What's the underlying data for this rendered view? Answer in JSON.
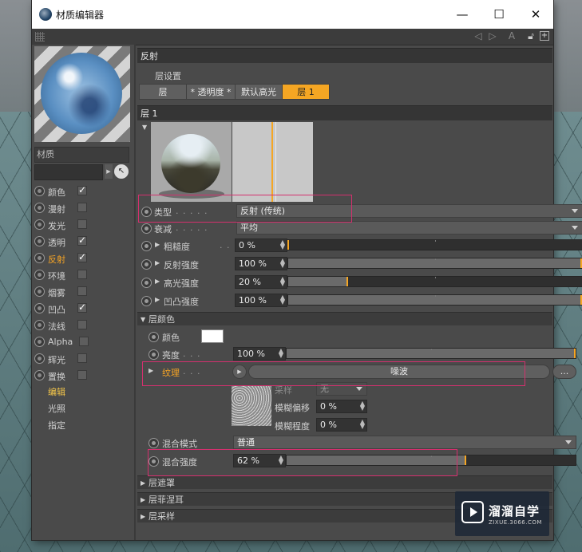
{
  "window": {
    "title": "材质编辑器",
    "minimize": "—",
    "maximize": "☐",
    "close": "✕"
  },
  "material": {
    "name_label": "材质",
    "name_value": ""
  },
  "channels": [
    {
      "label": "颜色",
      "checked": "✓"
    },
    {
      "label": "漫射",
      "checked": ""
    },
    {
      "label": "发光",
      "checked": ""
    },
    {
      "label": "透明",
      "checked": "✓"
    },
    {
      "label": "反射",
      "checked": "✓"
    },
    {
      "label": "环境",
      "checked": ""
    },
    {
      "label": "烟雾",
      "checked": ""
    },
    {
      "label": "凹凸",
      "checked": "✓"
    },
    {
      "label": "法线",
      "checked": ""
    },
    {
      "label": "Alpha",
      "checked": ""
    },
    {
      "label": "辉光",
      "checked": ""
    },
    {
      "label": "置换",
      "checked": ""
    }
  ],
  "sub_items": [
    "编辑",
    "光照",
    "指定"
  ],
  "reflect": {
    "header": "反射",
    "layer_settings": "层设置",
    "tabs": [
      "层",
      "* 透明度 *",
      "默认高光",
      "层 1"
    ],
    "layer_header": "层 1"
  },
  "params": {
    "type_label": "类型",
    "type_value": "反射 (传统)",
    "falloff_label": "衰减",
    "falloff_value": "平均",
    "roughness_label": "粗糙度",
    "roughness_value": "0 %",
    "roughness_fill": 0,
    "reflect_strength_label": "反射强度",
    "reflect_strength_value": "100 %",
    "reflect_strength_fill": 100,
    "specular_strength_label": "高光强度",
    "specular_strength_value": "20 %",
    "specular_strength_fill": 20,
    "bump_strength_label": "凹凸强度",
    "bump_strength_value": "100 %",
    "bump_strength_fill": 100
  },
  "layer_color": {
    "header": "层颜色",
    "color_label": "颜色",
    "brightness_label": "亮度",
    "brightness_value": "100 %",
    "brightness_fill": 100,
    "texture_label": "纹理",
    "texture_shader": "噪波",
    "more": "...",
    "sampling_label": "采样",
    "sampling_value": "无",
    "blur_offset_label": "模糊偏移",
    "blur_offset_value": "0 %",
    "blur_scale_label": "模糊程度",
    "blur_scale_value": "0 %",
    "blend_mode_label": "混合模式",
    "blend_mode_value": "普通",
    "blend_strength_label": "混合强度",
    "blend_strength_value": "62 %",
    "blend_strength_fill": 62
  },
  "collapsed_sections": [
    "层遮罩",
    "层菲涅耳",
    "层采样"
  ],
  "watermark": {
    "title": "溜溜自学",
    "url": "ZIXUE.3066.COM"
  },
  "colors": {
    "accent": "#f5a623",
    "annotation": "#d4306e"
  }
}
